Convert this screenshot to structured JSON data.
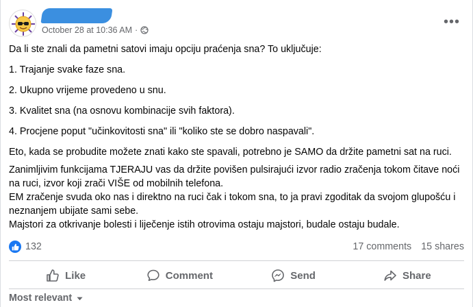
{
  "post": {
    "timestamp": "October 28 at 10:36 AM",
    "separator": "·",
    "audience_icon": "globe-icon",
    "more_icon": "more-options-icon",
    "more_glyph": "•••",
    "paragraphs": [
      "Da li ste znali da pametni satovi imaju opciju praćenja sna? To uključuje:",
      "1. Trajanje svake faze sna.",
      "2. Ukupno vrijeme provedeno u snu.",
      "3. Kvalitet sna (na osnovu kombinacije svih faktora).",
      "4. Procjene poput \"učinkovitosti sna\" ili \"koliko ste se dobro naspavali\".",
      "Eto, kada se probudite možete znati kako ste spavali, potrebno je SAMO da držite pametni sat na ruci.",
      "Zanimljivim funkcijama TJERAJU vas da držite povišen pulsirajući izvor radio zračenja tokom čitave noći na ruci, izvor koji zrači VIŠE od mobilnih telefona.",
      "EM zračenje svuda oko nas i direktno na ruci čak i tokom sna, to ja pravi zgoditak da svojom glupošću i neznanjem ubijate sami sebe.",
      "Majstori za otkrivanje bolesti i liječenje istih otrovima ostaju majstori, budale ostaju budale."
    ]
  },
  "reactions": {
    "count": "132",
    "comments": "17 comments",
    "shares": "15 shares"
  },
  "actions": {
    "like": "Like",
    "comment": "Comment",
    "send": "Send",
    "share": "Share"
  },
  "sort": {
    "label": "Most relevant"
  },
  "colors": {
    "accent": "#1877f2",
    "muted": "#65676b",
    "redaction": "#3b8fe0"
  }
}
